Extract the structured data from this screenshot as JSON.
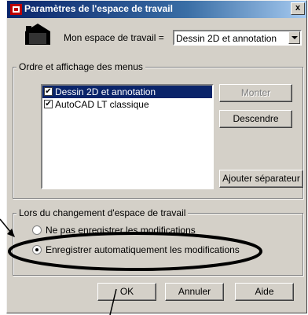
{
  "dialog": {
    "title": "Paramètres de l'espace de travail",
    "close_label": "x"
  },
  "workspace": {
    "label": "Mon espace de travail =",
    "selected": "Dessin 2D et annotation"
  },
  "menus_group": {
    "legend": "Ordre et affichage des menus",
    "items": [
      {
        "label": "Dessin 2D et annotation",
        "checked": true,
        "selected": true
      },
      {
        "label": "AutoCAD LT classique",
        "checked": true,
        "selected": false
      }
    ],
    "move_up_label": "Monter",
    "move_down_label": "Descendre",
    "add_separator_label": "Ajouter séparateur"
  },
  "change_group": {
    "legend": "Lors du changement d'espace de travail",
    "options": [
      {
        "label": "Ne pas enregistrer les modifications",
        "selected": false
      },
      {
        "label": "Enregistrer automatiquement les modifications",
        "selected": true
      }
    ]
  },
  "buttons": {
    "ok": "OK",
    "cancel": "Annuler",
    "help": "Aide"
  },
  "check_glyph": "✔"
}
